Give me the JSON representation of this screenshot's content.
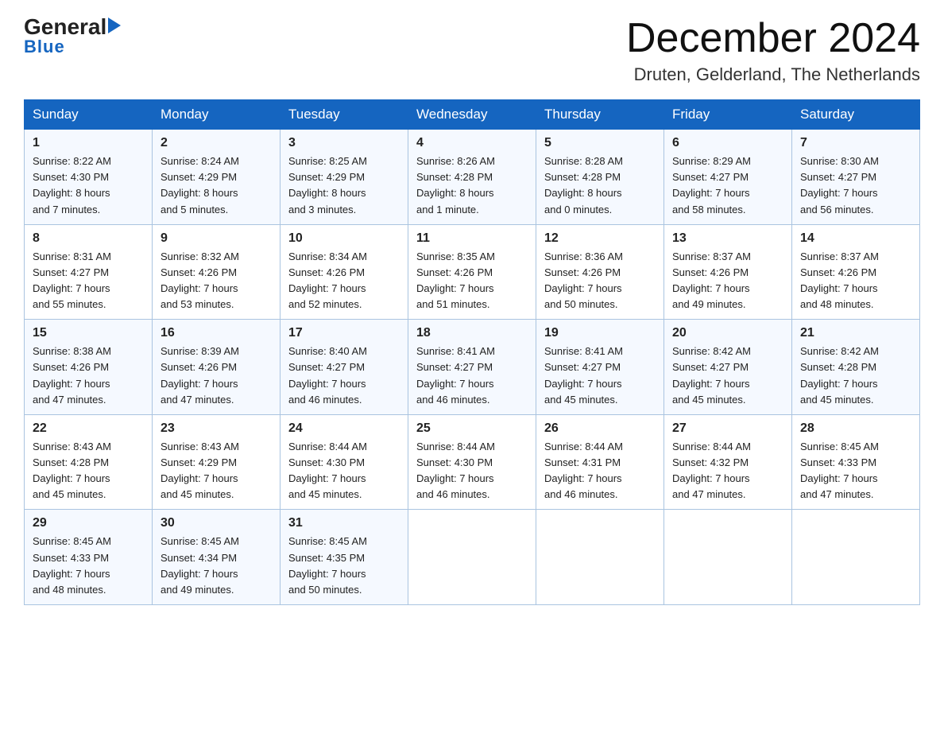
{
  "logo": {
    "text_general": "General",
    "text_blue": "Blue",
    "tagline": "Blue"
  },
  "calendar": {
    "title": "December 2024",
    "subtitle": "Druten, Gelderland, The Netherlands",
    "days_of_week": [
      "Sunday",
      "Monday",
      "Tuesday",
      "Wednesday",
      "Thursday",
      "Friday",
      "Saturday"
    ],
    "weeks": [
      [
        {
          "day": "1",
          "sunrise": "8:22 AM",
          "sunset": "4:30 PM",
          "daylight": "8 hours and 7 minutes."
        },
        {
          "day": "2",
          "sunrise": "8:24 AM",
          "sunset": "4:29 PM",
          "daylight": "8 hours and 5 minutes."
        },
        {
          "day": "3",
          "sunrise": "8:25 AM",
          "sunset": "4:29 PM",
          "daylight": "8 hours and 3 minutes."
        },
        {
          "day": "4",
          "sunrise": "8:26 AM",
          "sunset": "4:28 PM",
          "daylight": "8 hours and 1 minute."
        },
        {
          "day": "5",
          "sunrise": "8:28 AM",
          "sunset": "4:28 PM",
          "daylight": "8 hours and 0 minutes."
        },
        {
          "day": "6",
          "sunrise": "8:29 AM",
          "sunset": "4:27 PM",
          "daylight": "7 hours and 58 minutes."
        },
        {
          "day": "7",
          "sunrise": "8:30 AM",
          "sunset": "4:27 PM",
          "daylight": "7 hours and 56 minutes."
        }
      ],
      [
        {
          "day": "8",
          "sunrise": "8:31 AM",
          "sunset": "4:27 PM",
          "daylight": "7 hours and 55 minutes."
        },
        {
          "day": "9",
          "sunrise": "8:32 AM",
          "sunset": "4:26 PM",
          "daylight": "7 hours and 53 minutes."
        },
        {
          "day": "10",
          "sunrise": "8:34 AM",
          "sunset": "4:26 PM",
          "daylight": "7 hours and 52 minutes."
        },
        {
          "day": "11",
          "sunrise": "8:35 AM",
          "sunset": "4:26 PM",
          "daylight": "7 hours and 51 minutes."
        },
        {
          "day": "12",
          "sunrise": "8:36 AM",
          "sunset": "4:26 PM",
          "daylight": "7 hours and 50 minutes."
        },
        {
          "day": "13",
          "sunrise": "8:37 AM",
          "sunset": "4:26 PM",
          "daylight": "7 hours and 49 minutes."
        },
        {
          "day": "14",
          "sunrise": "8:37 AM",
          "sunset": "4:26 PM",
          "daylight": "7 hours and 48 minutes."
        }
      ],
      [
        {
          "day": "15",
          "sunrise": "8:38 AM",
          "sunset": "4:26 PM",
          "daylight": "7 hours and 47 minutes."
        },
        {
          "day": "16",
          "sunrise": "8:39 AM",
          "sunset": "4:26 PM",
          "daylight": "7 hours and 47 minutes."
        },
        {
          "day": "17",
          "sunrise": "8:40 AM",
          "sunset": "4:27 PM",
          "daylight": "7 hours and 46 minutes."
        },
        {
          "day": "18",
          "sunrise": "8:41 AM",
          "sunset": "4:27 PM",
          "daylight": "7 hours and 46 minutes."
        },
        {
          "day": "19",
          "sunrise": "8:41 AM",
          "sunset": "4:27 PM",
          "daylight": "7 hours and 45 minutes."
        },
        {
          "day": "20",
          "sunrise": "8:42 AM",
          "sunset": "4:27 PM",
          "daylight": "7 hours and 45 minutes."
        },
        {
          "day": "21",
          "sunrise": "8:42 AM",
          "sunset": "4:28 PM",
          "daylight": "7 hours and 45 minutes."
        }
      ],
      [
        {
          "day": "22",
          "sunrise": "8:43 AM",
          "sunset": "4:28 PM",
          "daylight": "7 hours and 45 minutes."
        },
        {
          "day": "23",
          "sunrise": "8:43 AM",
          "sunset": "4:29 PM",
          "daylight": "7 hours and 45 minutes."
        },
        {
          "day": "24",
          "sunrise": "8:44 AM",
          "sunset": "4:30 PM",
          "daylight": "7 hours and 45 minutes."
        },
        {
          "day": "25",
          "sunrise": "8:44 AM",
          "sunset": "4:30 PM",
          "daylight": "7 hours and 46 minutes."
        },
        {
          "day": "26",
          "sunrise": "8:44 AM",
          "sunset": "4:31 PM",
          "daylight": "7 hours and 46 minutes."
        },
        {
          "day": "27",
          "sunrise": "8:44 AM",
          "sunset": "4:32 PM",
          "daylight": "7 hours and 47 minutes."
        },
        {
          "day": "28",
          "sunrise": "8:45 AM",
          "sunset": "4:33 PM",
          "daylight": "7 hours and 47 minutes."
        }
      ],
      [
        {
          "day": "29",
          "sunrise": "8:45 AM",
          "sunset": "4:33 PM",
          "daylight": "7 hours and 48 minutes."
        },
        {
          "day": "30",
          "sunrise": "8:45 AM",
          "sunset": "4:34 PM",
          "daylight": "7 hours and 49 minutes."
        },
        {
          "day": "31",
          "sunrise": "8:45 AM",
          "sunset": "4:35 PM",
          "daylight": "7 hours and 50 minutes."
        },
        null,
        null,
        null,
        null
      ]
    ],
    "labels": {
      "sunrise": "Sunrise:",
      "sunset": "Sunset:",
      "daylight": "Daylight:"
    }
  }
}
